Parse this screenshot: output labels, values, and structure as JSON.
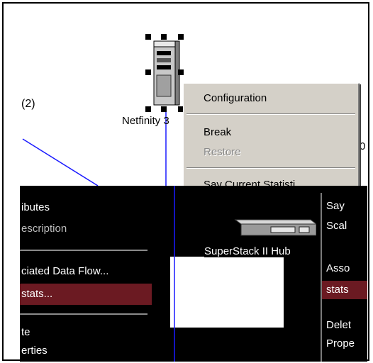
{
  "diagram": {
    "count_label": "(2)",
    "server_label": "Netfinity 3",
    "hub_label": "SuperStack II Hub",
    "edge_fragment_label": "0",
    "colors": {
      "link": "#1a1aff",
      "menu_bg": "#d4d0c8",
      "selection": "#6b1a22"
    }
  },
  "context_menu": {
    "items": [
      {
        "label": "Configuration",
        "enabled": true
      },
      {
        "label": "Break",
        "enabled": true
      },
      {
        "label": "Restore",
        "enabled": false
      },
      {
        "label": "Say Current Statisti",
        "enabled": true
      }
    ]
  },
  "left_menu": {
    "items": [
      {
        "label": "ibutes",
        "state": "normal"
      },
      {
        "label": "escription",
        "state": "ghost"
      },
      {
        "label": "ciated Data Flow...",
        "state": "normal"
      },
      {
        "label": "stats...",
        "state": "selected"
      },
      {
        "label": "te",
        "state": "normal"
      },
      {
        "label": "erties",
        "state": "normal"
      }
    ]
  },
  "right_menu": {
    "items": [
      {
        "label": "Say",
        "state": "normal"
      },
      {
        "label": "Scal",
        "state": "normal"
      },
      {
        "label": "Asso",
        "state": "normal"
      },
      {
        "label": "stats",
        "state": "selected"
      },
      {
        "label": "Delet",
        "state": "normal"
      },
      {
        "label": "Prope",
        "state": "normal"
      }
    ]
  }
}
